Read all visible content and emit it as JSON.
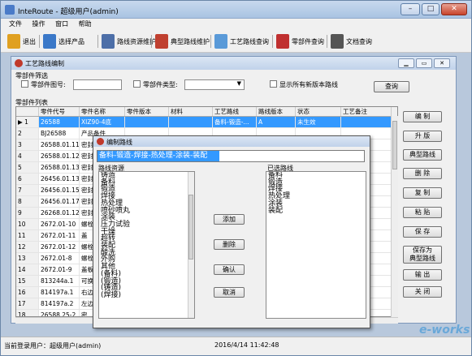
{
  "app": {
    "title": "InteRoute - 超级用户(admin)",
    "min": "–",
    "max": "□",
    "close": "✕"
  },
  "menu": [
    "文件",
    "操作",
    "窗口",
    "帮助"
  ],
  "toolbar": [
    {
      "label": "退出",
      "icon": "exit-icon",
      "color": "#e0a020"
    },
    {
      "label": "选择产品",
      "icon": "search-product-icon",
      "color": "#3a78c8"
    },
    {
      "label": "路线资源维护",
      "icon": "route-resource-icon",
      "color": "#4d6fa8"
    },
    {
      "label": "典型路线维护",
      "icon": "typical-route-icon",
      "color": "#c04030"
    },
    {
      "label": "工艺路线查询",
      "icon": "process-route-query-icon",
      "color": "#5a9ad8"
    },
    {
      "label": "零部件查询",
      "icon": "part-query-icon",
      "color": "#c03030"
    },
    {
      "label": "文档查询",
      "icon": "document-query-icon",
      "color": "#555555"
    }
  ],
  "child": {
    "title": "工艺路线编制",
    "filter_group": "零部件筛选",
    "filter_part_no": "零部件图号:",
    "filter_part_type": "零部件类型:",
    "filter_show_new": "显示所有新版本路线",
    "query_btn": "查询",
    "list_group": "零部件列表",
    "columns": [
      "零件代号",
      "零件名称",
      "零件版本",
      "材料",
      "工艺路线",
      "路线版本",
      "状态",
      "工艺备注"
    ],
    "rows": [
      {
        "mark": "▶ 1",
        "code": "26588",
        "name": "XIZ90-4底",
        "ver": "",
        "mat": "",
        "route": "备料-锻造-...",
        "rver": "A",
        "state": "未生效",
        "note": ""
      },
      {
        "mark": "2",
        "code": "BJ26588",
        "name": "产品备件",
        "ver": "",
        "mat": "",
        "route": "",
        "rver": "",
        "state": "",
        "note": ""
      },
      {
        "mark": "3",
        "code": "26588.01.11",
        "name": "密封",
        "ver": "",
        "mat": "",
        "route": "",
        "rver": "",
        "state": "",
        "note": ""
      },
      {
        "mark": "4",
        "code": "26588.01.12",
        "name": "密封",
        "ver": "",
        "mat": "",
        "route": "",
        "rver": "",
        "state": "",
        "note": ""
      },
      {
        "mark": "5",
        "code": "26588.01.13",
        "name": "密封",
        "ver": "",
        "mat": "",
        "route": "",
        "rver": "",
        "state": "",
        "note": ""
      },
      {
        "mark": "6",
        "code": "26456.01.13",
        "name": "密封",
        "ver": "",
        "mat": "",
        "route": "",
        "rver": "",
        "state": "",
        "note": ""
      },
      {
        "mark": "7",
        "code": "26456.01.15",
        "name": "密封",
        "ver": "",
        "mat": "",
        "route": "",
        "rver": "",
        "state": "",
        "note": ""
      },
      {
        "mark": "8",
        "code": "26456.01.17",
        "name": "密封",
        "ver": "",
        "mat": "",
        "route": "",
        "rver": "",
        "state": "",
        "note": ""
      },
      {
        "mark": "9",
        "code": "26268.01.12",
        "name": "密封",
        "ver": "",
        "mat": "",
        "route": "",
        "rver": "",
        "state": "",
        "note": ""
      },
      {
        "mark": "10",
        "code": "2672.01-10",
        "name": "螺栓",
        "ver": "",
        "mat": "",
        "route": "",
        "rver": "",
        "state": "",
        "note": ""
      },
      {
        "mark": "11",
        "code": "2672.01-11",
        "name": "盖",
        "ver": "",
        "mat": "",
        "route": "",
        "rver": "",
        "state": "",
        "note": ""
      },
      {
        "mark": "12",
        "code": "2672.01-12",
        "name": "螺栓",
        "ver": "",
        "mat": "",
        "route": "",
        "rver": "",
        "state": "",
        "note": ""
      },
      {
        "mark": "13",
        "code": "2672.01-8",
        "name": "螺栓",
        "ver": "",
        "mat": "",
        "route": "",
        "rver": "",
        "state": "",
        "note": ""
      },
      {
        "mark": "14",
        "code": "2672.01-9",
        "name": "盖板",
        "ver": "",
        "mat": "",
        "route": "",
        "rver": "",
        "state": "",
        "note": ""
      },
      {
        "mark": "15",
        "code": "813244a.1",
        "name": "可换",
        "ver": "",
        "mat": "",
        "route": "",
        "rver": "",
        "state": "",
        "note": ""
      },
      {
        "mark": "16",
        "code": "814197a.1",
        "name": "右边",
        "ver": "",
        "mat": "",
        "route": "",
        "rver": "",
        "state": "",
        "note": ""
      },
      {
        "mark": "17",
        "code": "814197a.2",
        "name": "左边",
        "ver": "",
        "mat": "",
        "route": "",
        "rver": "",
        "state": "",
        "note": ""
      },
      {
        "mark": "18",
        "code": "26588.25-2",
        "name": "密",
        "ver": "",
        "mat": "",
        "route": "",
        "rver": "",
        "state": "",
        "note": ""
      }
    ],
    "side_buttons": [
      "编 制",
      "升 版",
      "典型路线",
      "删 除",
      "复 制",
      "粘 贴",
      "保 存",
      "保存为\n典型路线",
      "输 出",
      "关 闭"
    ]
  },
  "dialog": {
    "title": "编制路线",
    "route_value": "备料-锻造-焊接-热处理-涂装-装配",
    "left_label": "路线资源",
    "right_label": "已选路线",
    "resources": [
      "铸造",
      "备料",
      "锻造",
      "焊接",
      "热处理",
      "喷砂喷丸",
      "涂装",
      "压力试验",
      "干燥",
      "超转",
      "装配",
      "酸洗",
      "外购",
      "其他",
      "(备料)",
      "(锻造)",
      "(铸造)",
      "(焊接)"
    ],
    "selected": [
      "备料",
      "锻造",
      "焊接",
      "热处理",
      "涂装",
      "装配"
    ],
    "add": "添加",
    "delete": "删除",
    "ok": "确认",
    "cancel": "取消"
  },
  "status": {
    "user": "当前登录用户：超级用户(admin)",
    "time": "2016/4/14 11:42:48"
  },
  "watermark": "e-works"
}
